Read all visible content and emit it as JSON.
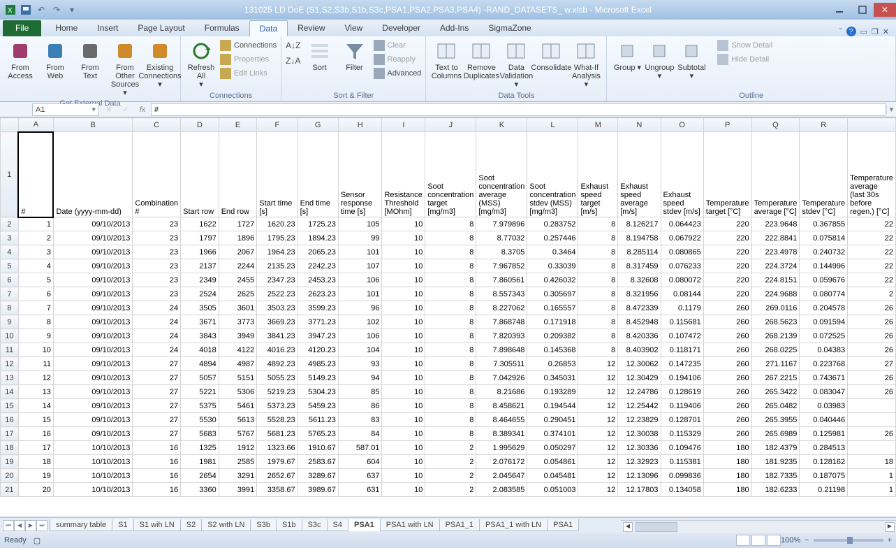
{
  "title": "131025 LD DoE (S1,S2,S3b,S1b,S3c,PSA1,PSA2,PSA3,PSA4) -RAND_DATASETS_ w.xlsb  -  Microsoft Excel",
  "ribbon_tabs": [
    "File",
    "Home",
    "Insert",
    "Page Layout",
    "Formulas",
    "Data",
    "Review",
    "View",
    "Developer",
    "Add-Ins",
    "SigmaZone"
  ],
  "active_tab_index": 5,
  "ribbon": {
    "get_external": {
      "label": "Get External Data",
      "btns": [
        "From Access",
        "From Web",
        "From Text",
        "From Other Sources",
        "Existing Connections"
      ]
    },
    "connections": {
      "label": "Connections",
      "refresh": "Refresh All",
      "items": [
        "Connections",
        "Properties",
        "Edit Links"
      ]
    },
    "sort_filter": {
      "label": "Sort & Filter",
      "sort": "Sort",
      "filter": "Filter",
      "items": [
        "Clear",
        "Reapply",
        "Advanced"
      ]
    },
    "data_tools": {
      "label": "Data Tools",
      "btns": [
        "Text to Columns",
        "Remove Duplicates",
        "Data Validation",
        "Consolidate",
        "What-If Analysis"
      ]
    },
    "outline": {
      "label": "Outline",
      "btns": [
        "Group",
        "Ungroup",
        "Subtotal"
      ],
      "items": [
        "Show Detail",
        "Hide Detail"
      ]
    }
  },
  "namebox": "A1",
  "formula": "#",
  "columns": [
    "A",
    "B",
    "C",
    "D",
    "E",
    "F",
    "G",
    "H",
    "I",
    "J",
    "K",
    "L",
    "M",
    "N",
    "O",
    "P",
    "Q",
    "R",
    ""
  ],
  "headers": [
    "#",
    "Date (yyyy-mm-dd)",
    "Combination #",
    "Start row",
    "End row",
    "Start time [s]",
    "End time [s]",
    "Sensor response time [s]",
    "Resistance Threshold [MOhm]",
    "Soot concentration target [mg/m3]",
    "Soot concentration average (MSS) [mg/m3]",
    "Soot concentration stdev (MSS) [mg/m3]",
    "Exhaust speed target [m/s]",
    "Exhaust speed average [m/s]",
    "Exhaust speed stdev [m/s]",
    "Temperature target [°C]",
    "Temperature average [°C]",
    "Temperature stdev [°C]",
    "Temperature average (last 30s before regen.) [°C]"
  ],
  "rows": [
    [
      "1",
      "09/10/2013",
      "23",
      "1622",
      "1727",
      "1620.23",
      "1725.23",
      "105",
      "10",
      "8",
      "7.979896",
      "0.283752",
      "8",
      "8.126217",
      "0.064423",
      "220",
      "223.9648",
      "0.367855",
      "22"
    ],
    [
      "2",
      "09/10/2013",
      "23",
      "1797",
      "1896",
      "1795.23",
      "1894.23",
      "99",
      "10",
      "8",
      "8.77032",
      "0.257446",
      "8",
      "8.194758",
      "0.067922",
      "220",
      "222.8841",
      "0.075814",
      "22"
    ],
    [
      "3",
      "09/10/2013",
      "23",
      "1966",
      "2067",
      "1964.23",
      "2065.23",
      "101",
      "10",
      "8",
      "8.3705",
      "0.3464",
      "8",
      "8.285114",
      "0.080865",
      "220",
      "223.4978",
      "0.240732",
      "22"
    ],
    [
      "4",
      "09/10/2013",
      "23",
      "2137",
      "2244",
      "2135.23",
      "2242.23",
      "107",
      "10",
      "8",
      "7.967852",
      "0.33039",
      "8",
      "8.317459",
      "0.076233",
      "220",
      "224.3724",
      "0.144996",
      "22"
    ],
    [
      "5",
      "09/10/2013",
      "23",
      "2349",
      "2455",
      "2347.23",
      "2453.23",
      "106",
      "10",
      "8",
      "7.860561",
      "0.426032",
      "8",
      "8.32608",
      "0.080072",
      "220",
      "224.8151",
      "0.059676",
      "22"
    ],
    [
      "6",
      "09/10/2013",
      "23",
      "2524",
      "2625",
      "2522.23",
      "2623.23",
      "101",
      "10",
      "8",
      "8.557343",
      "0.305697",
      "8",
      "8.321956",
      "0.08144",
      "220",
      "224.9688",
      "0.080774",
      "2"
    ],
    [
      "7",
      "09/10/2013",
      "24",
      "3505",
      "3601",
      "3503.23",
      "3599.23",
      "96",
      "10",
      "8",
      "8.227062",
      "0.165557",
      "8",
      "8.472339",
      "0.1179",
      "260",
      "269.0116",
      "0.204578",
      "26"
    ],
    [
      "8",
      "09/10/2013",
      "24",
      "3671",
      "3773",
      "3669.23",
      "3771.23",
      "102",
      "10",
      "8",
      "7.868748",
      "0.171918",
      "8",
      "8.452948",
      "0.115681",
      "260",
      "268.5623",
      "0.091594",
      "26"
    ],
    [
      "9",
      "09/10/2013",
      "24",
      "3843",
      "3949",
      "3841.23",
      "3947.23",
      "106",
      "10",
      "8",
      "7.820393",
      "0.209382",
      "8",
      "8.420336",
      "0.107472",
      "260",
      "268.2139",
      "0.072525",
      "26"
    ],
    [
      "10",
      "09/10/2013",
      "24",
      "4018",
      "4122",
      "4016.23",
      "4120.23",
      "104",
      "10",
      "8",
      "7.898648",
      "0.145368",
      "8",
      "8.403902",
      "0.118171",
      "260",
      "268.0225",
      "0.04383",
      "26"
    ],
    [
      "11",
      "09/10/2013",
      "27",
      "4894",
      "4987",
      "4892.23",
      "4985.23",
      "93",
      "10",
      "8",
      "7.305511",
      "0.26853",
      "12",
      "12.30062",
      "0.147235",
      "260",
      "271.1167",
      "0.223768",
      "27"
    ],
    [
      "12",
      "09/10/2013",
      "27",
      "5057",
      "5151",
      "5055.23",
      "5149.23",
      "94",
      "10",
      "8",
      "7.042926",
      "0.345031",
      "12",
      "12.30429",
      "0.194106",
      "260",
      "267.2215",
      "0.743671",
      "26"
    ],
    [
      "13",
      "09/10/2013",
      "27",
      "5221",
      "5306",
      "5219.23",
      "5304.23",
      "85",
      "10",
      "8",
      "8.21686",
      "0.193289",
      "12",
      "12.24786",
      "0.128619",
      "260",
      "265.3422",
      "0.083047",
      "26"
    ],
    [
      "14",
      "09/10/2013",
      "27",
      "5375",
      "5461",
      "5373.23",
      "5459.23",
      "86",
      "10",
      "8",
      "8.458621",
      "0.194544",
      "12",
      "12.25442",
      "0.119406",
      "260",
      "265.0482",
      "0.03983",
      ""
    ],
    [
      "15",
      "09/10/2013",
      "27",
      "5530",
      "5613",
      "5528.23",
      "5611.23",
      "83",
      "10",
      "8",
      "8.464655",
      "0.290451",
      "12",
      "12.23829",
      "0.128701",
      "260",
      "265.3955",
      "0.040446",
      ""
    ],
    [
      "16",
      "09/10/2013",
      "27",
      "5683",
      "5767",
      "5681.23",
      "5765.23",
      "84",
      "10",
      "8",
      "8.389341",
      "0.374101",
      "12",
      "12.30038",
      "0.115329",
      "260",
      "265.6989",
      "0.125981",
      "26"
    ],
    [
      "17",
      "10/10/2013",
      "16",
      "1325",
      "1912",
      "1323.66",
      "1910.67",
      "587.01",
      "10",
      "2",
      "1.995629",
      "0.050297",
      "12",
      "12.30336",
      "0.109476",
      "180",
      "182.4379",
      "0.284513",
      ""
    ],
    [
      "18",
      "10/10/2013",
      "16",
      "1981",
      "2585",
      "1979.67",
      "2583.67",
      "604",
      "10",
      "2",
      "2.076172",
      "0.054861",
      "12",
      "12.32923",
      "0.115381",
      "180",
      "181.9235",
      "0.128162",
      "18"
    ],
    [
      "19",
      "10/10/2013",
      "16",
      "2654",
      "3291",
      "2652.67",
      "3289.67",
      "637",
      "10",
      "2",
      "2.045647",
      "0.045481",
      "12",
      "12.13096",
      "0.099836",
      "180",
      "182.7335",
      "0.187075",
      "1"
    ],
    [
      "20",
      "10/10/2013",
      "16",
      "3360",
      "3991",
      "3358.67",
      "3989.67",
      "631",
      "10",
      "2",
      "2.083585",
      "0.051003",
      "12",
      "12.17803",
      "0.134058",
      "180",
      "182.6233",
      "0.21198",
      "1"
    ]
  ],
  "sheets": [
    "summary table",
    "S1",
    "S1 wih LN",
    "S2",
    "S2 with LN",
    "S3b",
    "S1b",
    "S3c",
    "S4",
    "PSA1",
    "PSA1 with LN",
    "PSA1_1",
    "PSA1_1 with LN",
    "PSA1"
  ],
  "active_sheet_index": 9,
  "status": "Ready",
  "zoom": "100%"
}
